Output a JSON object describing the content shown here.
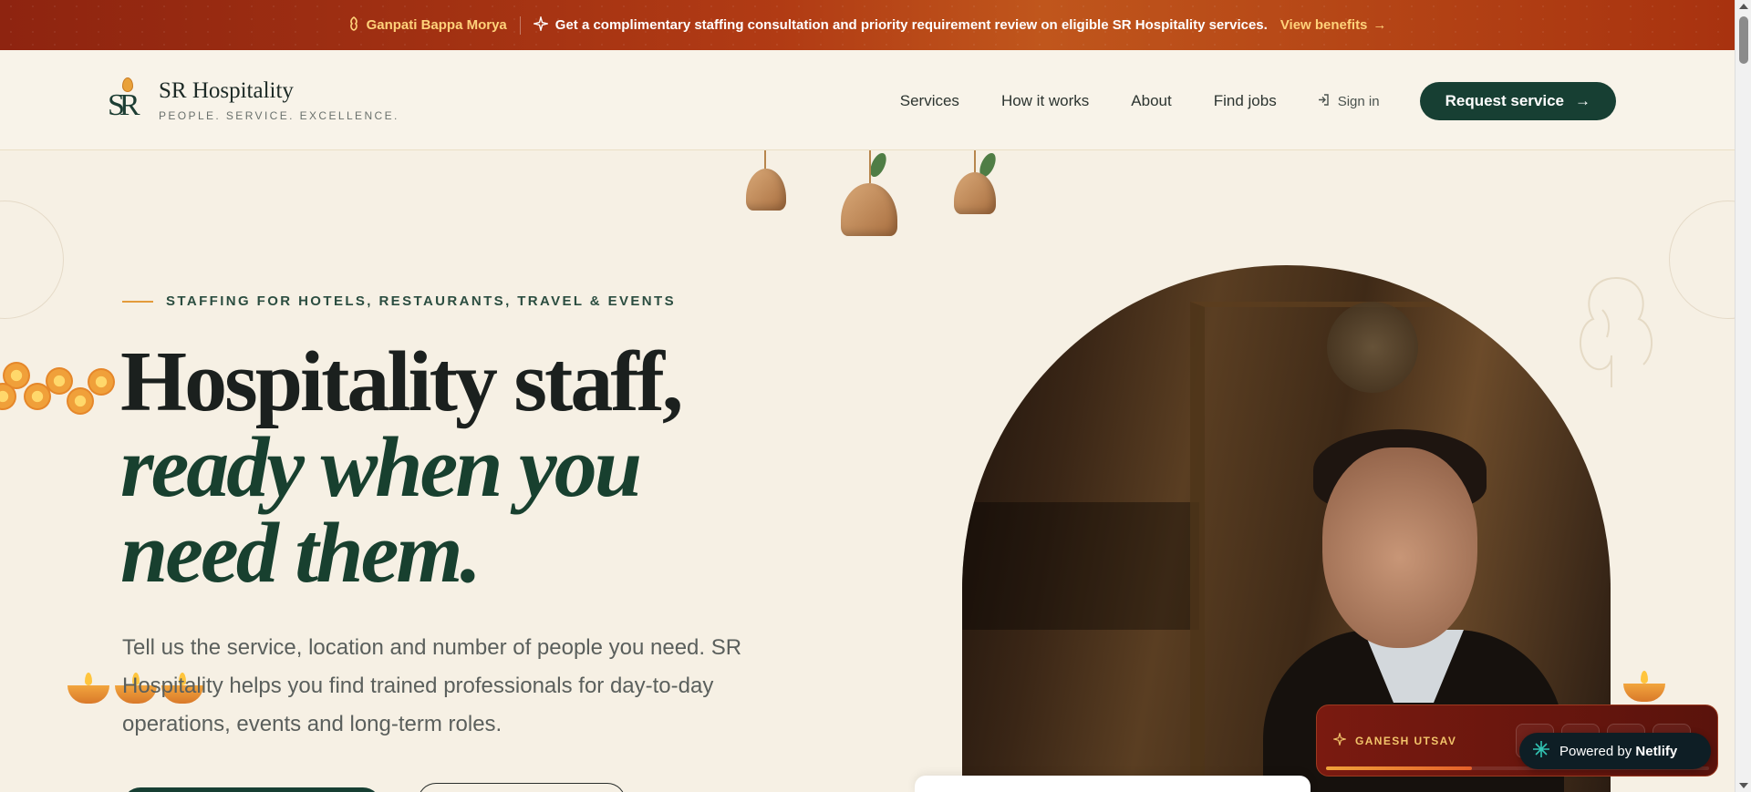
{
  "announcement": {
    "festival": "Ganpati Bappa Morya",
    "message": "Get a complimentary staffing consultation and priority requirement review on eligible SR Hospitality services.",
    "link": "View benefits"
  },
  "brand": {
    "name": "SR Hospitality",
    "tagline": "PEOPLE. SERVICE. EXCELLENCE.",
    "logo_letters": "SR"
  },
  "nav": {
    "items": [
      "Services",
      "How it works",
      "About",
      "Find jobs"
    ],
    "signin": "Sign in",
    "cta": "Request service"
  },
  "hero": {
    "eyebrow": "STAFFING FOR HOTELS, RESTAURANTS, TRAVEL & EVENTS",
    "headline_line1": "Hospitality staff,",
    "headline_line2": "ready when you",
    "headline_line3": "need them.",
    "subtext": "Tell us the service, location and number of people you need. SR Hospitality helps you find trained professionals for day-to-day operations, events and long-term roles."
  },
  "festival_widget": {
    "label": "GANESH UTSAV",
    "progress": 0.38
  },
  "badge": {
    "prefix": "Powered by",
    "brand": "Netlify"
  },
  "colors": {
    "accent_green": "#173f33",
    "topbar_red": "#a8320f",
    "gold": "#ffd27a",
    "background": "#f6f0e4"
  }
}
